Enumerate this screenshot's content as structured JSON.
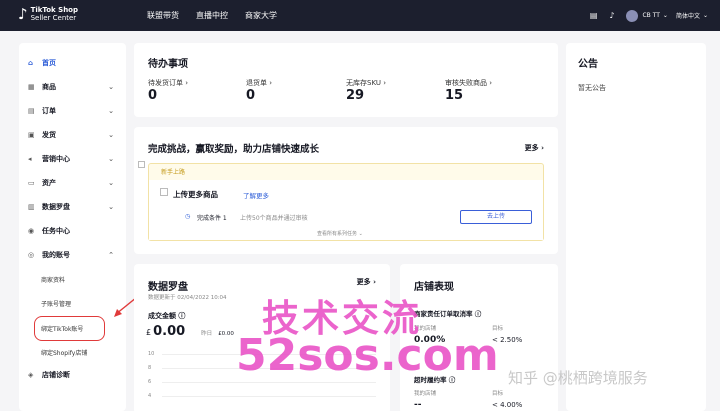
{
  "topbar": {
    "logo_mark": "♪",
    "logo_title": "TikTok Shop",
    "logo_subtitle": "Seller Center",
    "nav": [
      "联盟带货",
      "直播中控",
      "商家大学"
    ],
    "user": "CB TT",
    "language": "简体中文"
  },
  "sidebar": {
    "items": [
      {
        "label": "首页",
        "icon": "home-icon",
        "glyph": "⌂"
      },
      {
        "label": "商品",
        "icon": "product-icon",
        "glyph": "▦"
      },
      {
        "label": "订单",
        "icon": "order-icon",
        "glyph": "▤"
      },
      {
        "label": "发货",
        "icon": "truck-icon",
        "glyph": "▣"
      },
      {
        "label": "营销中心",
        "icon": "megaphone-icon",
        "glyph": "◂"
      },
      {
        "label": "资产",
        "icon": "wallet-icon",
        "glyph": "▭"
      },
      {
        "label": "数据罗盘",
        "icon": "chart-icon",
        "glyph": "▥"
      },
      {
        "label": "任务中心",
        "icon": "task-icon",
        "glyph": "◉"
      },
      {
        "label": "我的账号",
        "icon": "user-icon",
        "glyph": "◎"
      },
      {
        "label": "店铺诊断",
        "icon": "diagnosis-icon",
        "glyph": "◈"
      }
    ],
    "sub_items": [
      "商家资料",
      "子账号管理",
      "绑定TikTok账号",
      "绑定Shopify店铺"
    ]
  },
  "todo": {
    "title": "待办事项",
    "stats": [
      {
        "label": "待发货订单 ›",
        "value": "0"
      },
      {
        "label": "退货单 ›",
        "value": "0"
      },
      {
        "label": "无库存SKU ›",
        "value": "29"
      },
      {
        "label": "审核失败商品 ›",
        "value": "15"
      }
    ]
  },
  "challenge": {
    "title": "完成挑战，赢取奖励，助力店铺快速成长",
    "more": "更多 ›",
    "tag": "新手上路",
    "task_title": "上传更多商品",
    "task_link": "了解更多",
    "condition": "完成条件 1",
    "condition_desc": "上传50个商品并通过审核",
    "action": "去上传",
    "view_all": "查看所有系列任务 ⌄"
  },
  "compass": {
    "title": "数据罗盘",
    "more": "更多 ›",
    "updated": "数据更新于 02/04/2022 10:04",
    "metric_label": "成交金额 ⓘ",
    "currency": "£",
    "value": "0.00",
    "yesterday_label": "昨日",
    "yesterday_value": "£0.00",
    "y_ticks": [
      "10",
      "8",
      "6",
      "4"
    ]
  },
  "performance": {
    "title": "店铺表现",
    "metrics": [
      {
        "label": "商家责任订单取消率 ⓘ",
        "mine_label": "我的店铺",
        "mine": "0.00%",
        "target_label": "目标",
        "target": "< 2.50%"
      },
      {
        "label": "超时履约率 ⓘ",
        "mine_label": "我的店铺",
        "mine": "--",
        "target_label": "目标",
        "target": "< 4.00%"
      }
    ]
  },
  "notice": {
    "title": "公告",
    "empty": "暂无公告"
  },
  "watermark": {
    "line1": "技术交流",
    "line2": "52sos.com",
    "zhihu": "知乎 @桃栖跨境服务"
  }
}
